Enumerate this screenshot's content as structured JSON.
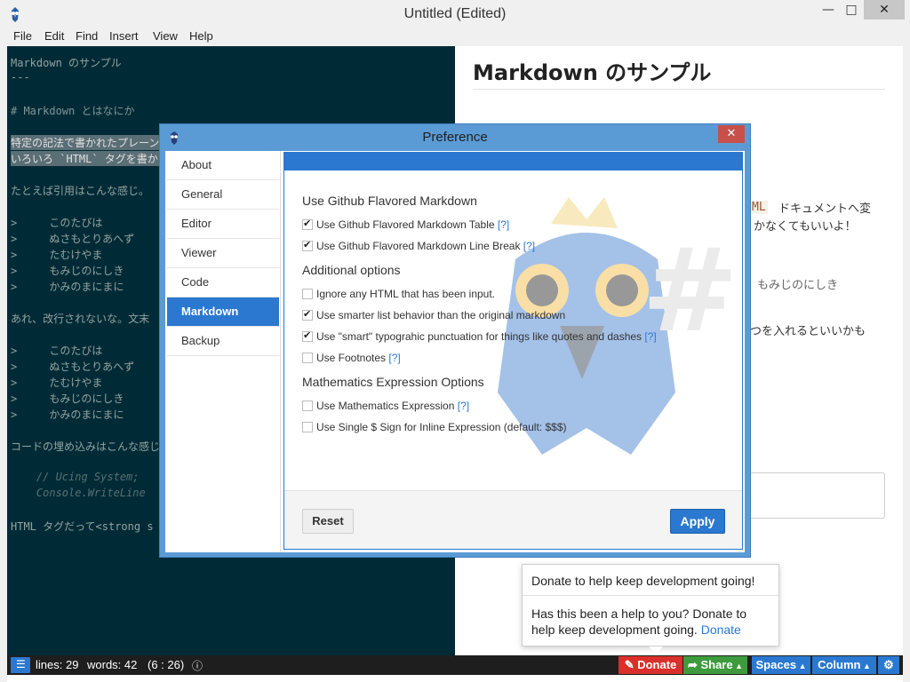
{
  "window": {
    "title": "Untitled (Edited)",
    "min": "—",
    "max": "□",
    "close": "✕"
  },
  "menu": [
    "File",
    "Edit",
    "Find",
    "Insert",
    "View",
    "Help"
  ],
  "editor": {
    "lines": [
      "Markdown のサンプル",
      "---",
      "",
      "# Markdown とはなにか",
      "",
      "特定の記法で書かれたプレーン",
      "いろいろ `HTML` タグを書か",
      "",
      "たとえば引用はこんな感じ。",
      "",
      ">     このたびは",
      ">     ぬさもとりあへず",
      ">     たむけやま",
      ">     もみじのにしき",
      ">     かみのまにまに",
      "",
      "あれ、改行されないな。文末",
      "",
      ">     このたびは",
      ">     ぬさもとりあへず",
      ">     たむけやま",
      ">     もみじのにしき",
      ">     かみのまにまに",
      "",
      "コードの埋め込みはこんな感じ",
      "",
      "    // Ucing System;",
      "    Console.WriteLine",
      "",
      "HTML タグだって<strong s"
    ]
  },
  "preview": {
    "title": "Markdown のサンプル",
    "frag1": "ML",
    "frag2": "ドキュメントへ変",
    "frag3": "かなくてもいいよ！",
    "frag4": "もみじのにしき",
    "frag5": "つを入れるといいかも"
  },
  "dialog": {
    "title": "Preference",
    "close": "✕",
    "nav": [
      "About",
      "General",
      "Editor",
      "Viewer",
      "Code",
      "Markdown",
      "Backup"
    ],
    "active_nav": "Markdown",
    "sections": [
      {
        "heading": "Use Github Flavored Markdown",
        "options": [
          {
            "label": "Use Github Flavored Markdown Table",
            "checked": true,
            "help": "[?]"
          },
          {
            "label": "Use Github Flavored Markdown Line Break",
            "checked": true,
            "help": "[?]"
          }
        ]
      },
      {
        "heading": "Additional options",
        "options": [
          {
            "label": "Ignore any HTML that has been input.",
            "checked": false,
            "help": ""
          },
          {
            "label": "Use smarter list behavior than the original markdown",
            "checked": true,
            "help": ""
          },
          {
            "label": "Use \"smart\" typograhic punctuation for things like quotes and dashes",
            "checked": true,
            "help": "[?]"
          },
          {
            "label": "Use Footnotes",
            "checked": false,
            "help": "[?]"
          }
        ]
      },
      {
        "heading": "Mathematics Expression Options",
        "options": [
          {
            "label": "Use Mathematics Expression",
            "checked": false,
            "help": "[?]"
          },
          {
            "label": "Use Single $ Sign for Inline Expression (default: $$$)",
            "checked": false,
            "help": ""
          }
        ]
      }
    ],
    "reset_label": "Reset",
    "apply_label": "Apply"
  },
  "popup": {
    "title": "Donate to help keep development going!",
    "body": "Has this been a help to you? Donate to help keep development going.",
    "link": "Donate"
  },
  "status": {
    "lines": "lines: 29",
    "words": "words: 42",
    "position": "(6 : 26)",
    "info_icon": "ⓘ",
    "donate": "Donate",
    "share": "Share",
    "spaces": "Spaces",
    "column": "Column",
    "gear": "⚙"
  }
}
